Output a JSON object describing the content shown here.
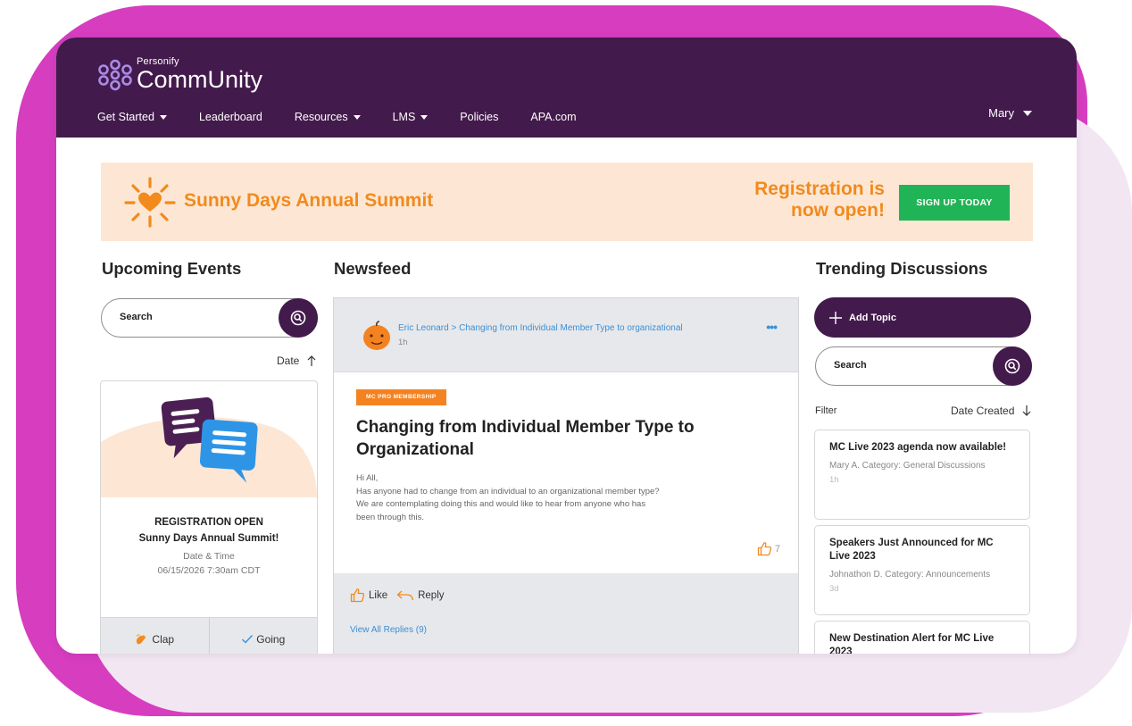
{
  "brand": {
    "small": "Personify",
    "name": "CommUnity"
  },
  "nav": [
    {
      "label": "Get Started",
      "dropdown": true
    },
    {
      "label": "Leaderboard",
      "dropdown": false
    },
    {
      "label": "Resources",
      "dropdown": true
    },
    {
      "label": "LMS",
      "dropdown": true
    },
    {
      "label": "Policies",
      "dropdown": false
    },
    {
      "label": "APA.com",
      "dropdown": false
    }
  ],
  "user": {
    "name": "Mary"
  },
  "banner": {
    "title": "Sunny Days Annual Summit",
    "registration_line1": "Registration is",
    "registration_line2": "now open!",
    "cta": "SIGN UP TODAY"
  },
  "events": {
    "title": "Upcoming Events",
    "search_placeholder": "Search",
    "sort_label": "Date",
    "card": {
      "status": "REGISTRATION OPEN",
      "name": "Sunny Days Annual Summit!",
      "datetime_label": "Date & Time",
      "datetime": "06/15/2026 7:30am CDT",
      "action_clap": "Clap",
      "action_going": "Going"
    }
  },
  "newsfeed": {
    "title": "Newsfeed",
    "post": {
      "author_line": "Eric Leonard > Changing from Individual Member Type to organizational",
      "time": "1h",
      "tag": "MC PRO MEMBERSHIP",
      "title": "Changing from Individual Member Type to Organizational",
      "body": [
        "Hi All,",
        "Has anyone had to change from an individual to an organizational member type?",
        "We are contemplating doing this and would like to hear from anyone who has",
        "been through this."
      ],
      "likes": "7",
      "action_like": "Like",
      "action_reply": "Reply",
      "view_replies": "View All Replies (9)"
    }
  },
  "trending": {
    "title": "Trending Discussions",
    "add_topic": "Add Topic",
    "search_placeholder": "Search",
    "filter_label": "Filter",
    "sort_label": "Date Created",
    "items": [
      {
        "title": "MC Live 2023 agenda now available!",
        "meta": "Mary A. Category: General Discussions",
        "time": "1h"
      },
      {
        "title": "Speakers Just Announced for MC Live 2023",
        "meta": "Johnathon D. Category: Announcements",
        "time": "3d"
      },
      {
        "title": "New Destination Alert for MC Live 2023",
        "meta": "",
        "time": ""
      }
    ]
  },
  "colors": {
    "header_purple": "#431a4c",
    "accent_orange": "#f28a1d",
    "cta_green": "#21b457",
    "link_blue": "#3c8fd4",
    "banner_bg": "#fde7d4",
    "magenta_frame": "#d63dbf"
  }
}
